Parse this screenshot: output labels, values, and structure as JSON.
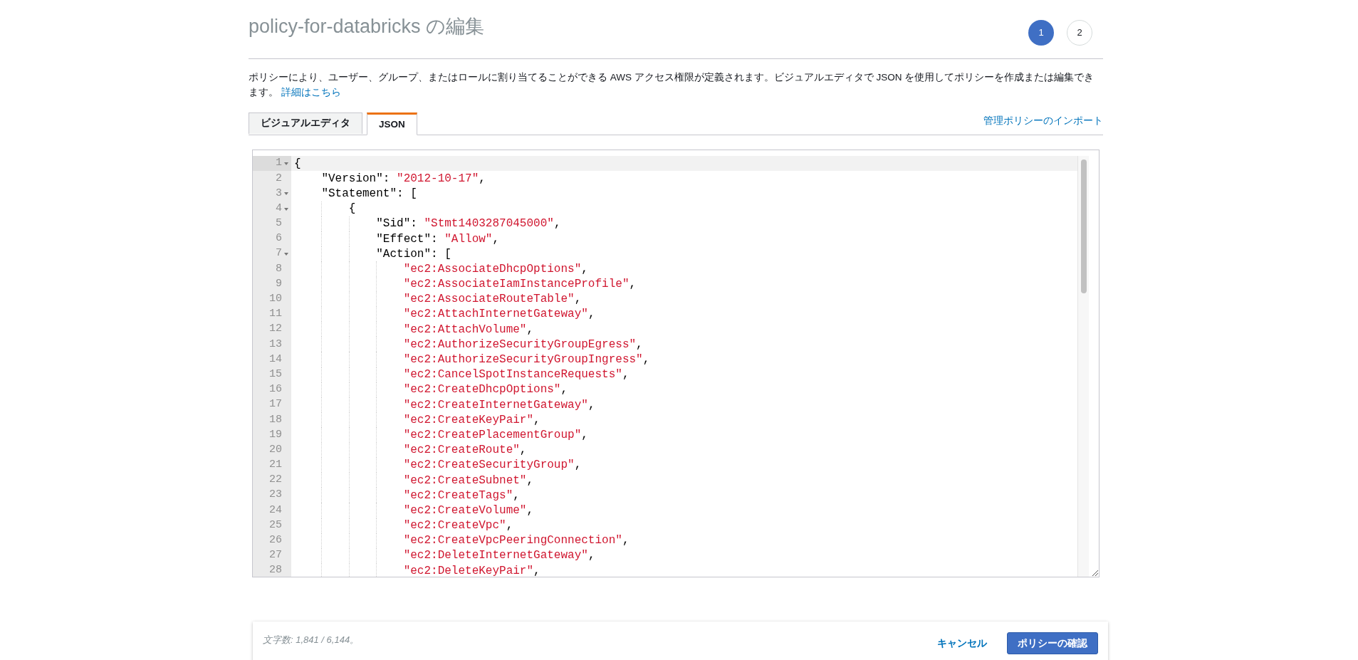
{
  "page_title": "policy-for-databricks の編集",
  "steps": [
    {
      "label": "1",
      "selected": true
    },
    {
      "label": "2",
      "selected": false
    }
  ],
  "description": {
    "text": "ポリシーにより、ユーザー、グループ、またはロールに割り当てることができる AWS アクセス権限が定義されます。ビジュアルエディタで JSON を使用してポリシーを作成または編集できます。",
    "link": "詳細はこちら"
  },
  "tabs": [
    {
      "label": "ビジュアルエディタ",
      "selected": false
    },
    {
      "label": "JSON",
      "selected": true
    }
  ],
  "import_link": "管理ポリシーのインポート",
  "editor": {
    "lines": [
      {
        "number": "1",
        "foldable": true,
        "active": true,
        "tokens": [
          {
            "kind": "punct",
            "text": "{"
          }
        ]
      },
      {
        "number": "2",
        "foldable": false,
        "active": false,
        "tokens": [
          {
            "kind": "key",
            "text": "    \"Version\""
          },
          {
            "kind": "punct",
            "text": ": "
          },
          {
            "kind": "string",
            "text": "\"2012-10-17\""
          },
          {
            "kind": "punct",
            "text": ","
          }
        ]
      },
      {
        "number": "3",
        "foldable": true,
        "active": false,
        "tokens": [
          {
            "kind": "key",
            "text": "    \"Statement\""
          },
          {
            "kind": "punct",
            "text": ": ["
          }
        ]
      },
      {
        "number": "4",
        "foldable": true,
        "active": false,
        "tokens": [
          {
            "kind": "punct",
            "text": "        {"
          }
        ]
      },
      {
        "number": "5",
        "foldable": false,
        "active": false,
        "tokens": [
          {
            "kind": "key",
            "text": "            \"Sid\""
          },
          {
            "kind": "punct",
            "text": ": "
          },
          {
            "kind": "string",
            "text": "\"Stmt1403287045000\""
          },
          {
            "kind": "punct",
            "text": ","
          }
        ]
      },
      {
        "number": "6",
        "foldable": false,
        "active": false,
        "tokens": [
          {
            "kind": "key",
            "text": "            \"Effect\""
          },
          {
            "kind": "punct",
            "text": ": "
          },
          {
            "kind": "string",
            "text": "\"Allow\""
          },
          {
            "kind": "punct",
            "text": ","
          }
        ]
      },
      {
        "number": "7",
        "foldable": true,
        "active": false,
        "tokens": [
          {
            "kind": "key",
            "text": "            \"Action\""
          },
          {
            "kind": "punct",
            "text": ": ["
          }
        ]
      },
      {
        "number": "8",
        "foldable": false,
        "active": false,
        "tokens": [
          {
            "kind": "string",
            "text": "                \"ec2:AssociateDhcpOptions\""
          },
          {
            "kind": "punct",
            "text": ","
          }
        ]
      },
      {
        "number": "9",
        "foldable": false,
        "active": false,
        "tokens": [
          {
            "kind": "string",
            "text": "                \"ec2:AssociateIamInstanceProfile\""
          },
          {
            "kind": "punct",
            "text": ","
          }
        ]
      },
      {
        "number": "10",
        "foldable": false,
        "active": false,
        "tokens": [
          {
            "kind": "string",
            "text": "                \"ec2:AssociateRouteTable\""
          },
          {
            "kind": "punct",
            "text": ","
          }
        ]
      },
      {
        "number": "11",
        "foldable": false,
        "active": false,
        "tokens": [
          {
            "kind": "string",
            "text": "                \"ec2:AttachInternetGateway\""
          },
          {
            "kind": "punct",
            "text": ","
          }
        ]
      },
      {
        "number": "12",
        "foldable": false,
        "active": false,
        "tokens": [
          {
            "kind": "string",
            "text": "                \"ec2:AttachVolume\""
          },
          {
            "kind": "punct",
            "text": ","
          }
        ]
      },
      {
        "number": "13",
        "foldable": false,
        "active": false,
        "tokens": [
          {
            "kind": "string",
            "text": "                \"ec2:AuthorizeSecurityGroupEgress\""
          },
          {
            "kind": "punct",
            "text": ","
          }
        ]
      },
      {
        "number": "14",
        "foldable": false,
        "active": false,
        "tokens": [
          {
            "kind": "string",
            "text": "                \"ec2:AuthorizeSecurityGroupIngress\""
          },
          {
            "kind": "punct",
            "text": ","
          }
        ]
      },
      {
        "number": "15",
        "foldable": false,
        "active": false,
        "tokens": [
          {
            "kind": "string",
            "text": "                \"ec2:CancelSpotInstanceRequests\""
          },
          {
            "kind": "punct",
            "text": ","
          }
        ]
      },
      {
        "number": "16",
        "foldable": false,
        "active": false,
        "tokens": [
          {
            "kind": "string",
            "text": "                \"ec2:CreateDhcpOptions\""
          },
          {
            "kind": "punct",
            "text": ","
          }
        ]
      },
      {
        "number": "17",
        "foldable": false,
        "active": false,
        "tokens": [
          {
            "kind": "string",
            "text": "                \"ec2:CreateInternetGateway\""
          },
          {
            "kind": "punct",
            "text": ","
          }
        ]
      },
      {
        "number": "18",
        "foldable": false,
        "active": false,
        "tokens": [
          {
            "kind": "string",
            "text": "                \"ec2:CreateKeyPair\""
          },
          {
            "kind": "punct",
            "text": ","
          }
        ]
      },
      {
        "number": "19",
        "foldable": false,
        "active": false,
        "tokens": [
          {
            "kind": "string",
            "text": "                \"ec2:CreatePlacementGroup\""
          },
          {
            "kind": "punct",
            "text": ","
          }
        ]
      },
      {
        "number": "20",
        "foldable": false,
        "active": false,
        "tokens": [
          {
            "kind": "string",
            "text": "                \"ec2:CreateRoute\""
          },
          {
            "kind": "punct",
            "text": ","
          }
        ]
      },
      {
        "number": "21",
        "foldable": false,
        "active": false,
        "tokens": [
          {
            "kind": "string",
            "text": "                \"ec2:CreateSecurityGroup\""
          },
          {
            "kind": "punct",
            "text": ","
          }
        ]
      },
      {
        "number": "22",
        "foldable": false,
        "active": false,
        "tokens": [
          {
            "kind": "string",
            "text": "                \"ec2:CreateSubnet\""
          },
          {
            "kind": "punct",
            "text": ","
          }
        ]
      },
      {
        "number": "23",
        "foldable": false,
        "active": false,
        "tokens": [
          {
            "kind": "string",
            "text": "                \"ec2:CreateTags\""
          },
          {
            "kind": "punct",
            "text": ","
          }
        ]
      },
      {
        "number": "24",
        "foldable": false,
        "active": false,
        "tokens": [
          {
            "kind": "string",
            "text": "                \"ec2:CreateVolume\""
          },
          {
            "kind": "punct",
            "text": ","
          }
        ]
      },
      {
        "number": "25",
        "foldable": false,
        "active": false,
        "tokens": [
          {
            "kind": "string",
            "text": "                \"ec2:CreateVpc\""
          },
          {
            "kind": "punct",
            "text": ","
          }
        ]
      },
      {
        "number": "26",
        "foldable": false,
        "active": false,
        "tokens": [
          {
            "kind": "string",
            "text": "                \"ec2:CreateVpcPeeringConnection\""
          },
          {
            "kind": "punct",
            "text": ","
          }
        ]
      },
      {
        "number": "27",
        "foldable": false,
        "active": false,
        "tokens": [
          {
            "kind": "string",
            "text": "                \"ec2:DeleteInternetGateway\""
          },
          {
            "kind": "punct",
            "text": ","
          }
        ]
      },
      {
        "number": "28",
        "foldable": false,
        "active": false,
        "tokens": [
          {
            "kind": "string",
            "text": "                \"ec2:DeleteKeyPair\""
          },
          {
            "kind": "punct",
            "text": ","
          }
        ]
      }
    ]
  },
  "footer": {
    "char_count": "文字数: 1,841 / 6,144。",
    "cancel": "キャンセル",
    "confirm": "ポリシーの確認"
  }
}
